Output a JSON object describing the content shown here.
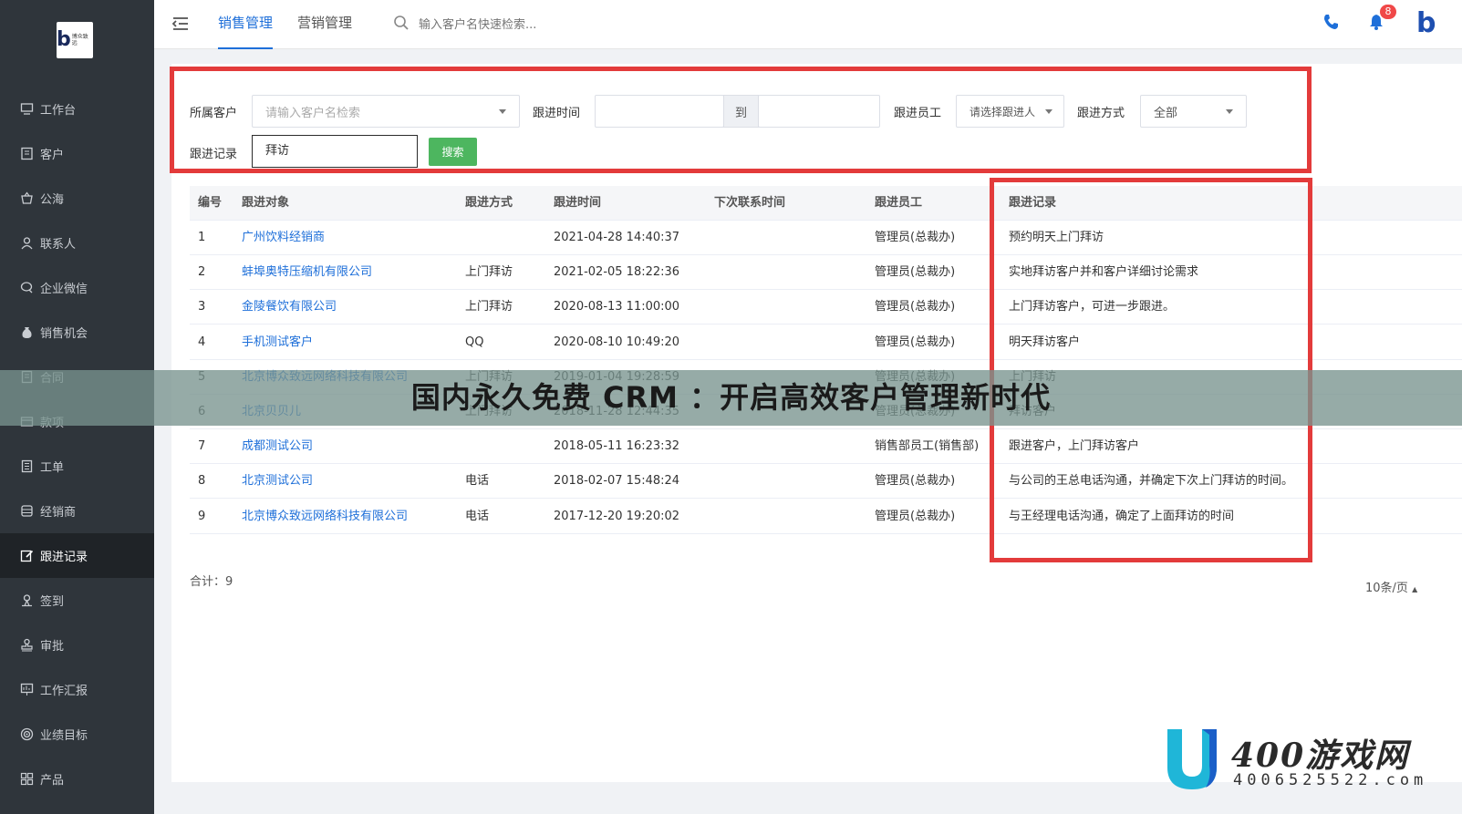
{
  "sidebar": {
    "logo_text": "博众致远",
    "items": [
      {
        "label": "工作台",
        "icon": "monitor-icon"
      },
      {
        "label": "客户",
        "icon": "building-icon"
      },
      {
        "label": "公海",
        "icon": "basket-icon"
      },
      {
        "label": "联系人",
        "icon": "person-icon"
      },
      {
        "label": "企业微信",
        "icon": "chat-icon"
      },
      {
        "label": "销售机会",
        "icon": "money-bag-icon"
      },
      {
        "label": "合同",
        "icon": "contract-icon"
      },
      {
        "label": "款项",
        "icon": "payment-icon"
      },
      {
        "label": "工单",
        "icon": "ticket-icon"
      },
      {
        "label": "经销商",
        "icon": "store-icon"
      },
      {
        "label": "跟进记录",
        "icon": "edit-icon"
      },
      {
        "label": "签到",
        "icon": "pin-icon"
      },
      {
        "label": "审批",
        "icon": "stamp-icon"
      },
      {
        "label": "工作汇报",
        "icon": "report-icon"
      },
      {
        "label": "业绩目标",
        "icon": "target-icon"
      },
      {
        "label": "产品",
        "icon": "grid-icon"
      }
    ],
    "active_index": 10
  },
  "topbar": {
    "tabs": [
      "销售管理",
      "营销管理"
    ],
    "search_placeholder": "输入客户名快速检索...",
    "notification_count": "8",
    "brand_letter": "b"
  },
  "filter": {
    "customer_label": "所属客户",
    "customer_placeholder": "请输入客户名检索",
    "time_label": "跟进时间",
    "time_to": "到",
    "staff_label": "跟进员工",
    "staff_placeholder": "请选择跟进人",
    "method_label": "跟进方式",
    "method_value": "全部",
    "record_label": "跟进记录",
    "record_value": "拜访",
    "search_button": "搜索"
  },
  "table": {
    "headers": [
      "编号",
      "跟进对象",
      "跟进方式",
      "跟进时间",
      "下次联系时间",
      "跟进员工",
      "跟进记录"
    ],
    "rows": [
      [
        "1",
        "广州饮料经销商",
        "",
        "2021-04-28 14:40:37",
        "",
        "管理员(总裁办)",
        "预约明天上门拜访"
      ],
      [
        "2",
        "蚌埠奥特压缩机有限公司",
        "上门拜访",
        "2021-02-05 18:22:36",
        "",
        "管理员(总裁办)",
        "实地拜访客户并和客户详细讨论需求"
      ],
      [
        "3",
        "金陵餐饮有限公司",
        "上门拜访",
        "2020-08-13 11:00:00",
        "",
        "管理员(总裁办)",
        "上门拜访客户，可进一步跟进。"
      ],
      [
        "4",
        "手机测试客户",
        "QQ",
        "2020-08-10 10:49:20",
        "",
        "管理员(总裁办)",
        "明天拜访客户"
      ],
      [
        "5",
        "北京博众致远网络科技有限公司",
        "上门拜访",
        "2019-01-04 19:28:59",
        "",
        "管理员(总裁办)",
        "上门拜访"
      ],
      [
        "6",
        "北京贝贝儿",
        "上门拜访",
        "2018-11-28 12:44:35",
        "",
        "管理员(总裁办)",
        "拜访客户"
      ],
      [
        "7",
        "成都测试公司",
        "",
        "2018-05-11 16:23:32",
        "",
        "销售部员工(销售部)",
        "跟进客户，上门拜访客户"
      ],
      [
        "8",
        "北京测试公司",
        "电话",
        "2018-02-07 15:48:24",
        "",
        "管理员(总裁办)",
        "与公司的王总电话沟通，并确定下次上门拜访的时间。"
      ],
      [
        "9",
        "北京博众致远网络科技有限公司",
        "电话",
        "2017-12-20 19:20:02",
        "",
        "管理员(总裁办)",
        "与王经理电话沟通，确定了上面拜访的时间"
      ]
    ],
    "total": "合计：9",
    "page_size": "10条/页"
  },
  "banner": {
    "title": "国内永久免费 CRM ：开启高效客户管理新时代"
  },
  "watermark": {
    "name": "400游戏网",
    "phone": "4006525522.com"
  },
  "colors": {
    "sidebar_bg": "#2f353b",
    "accent": "#1e6fd9",
    "highlight_box": "#e33b3b",
    "search_button": "#4db65f"
  }
}
